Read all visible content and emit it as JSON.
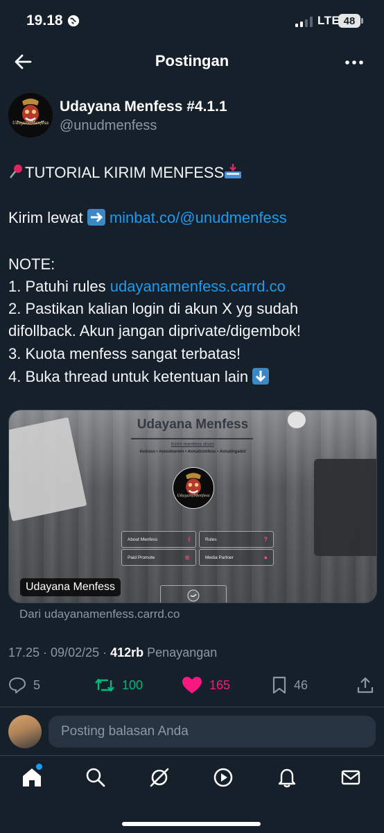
{
  "status_bar": {
    "time": "19.18",
    "network": "LTE",
    "battery": "48"
  },
  "header": {
    "title": "Postingan",
    "back_icon": "back-arrow-icon",
    "more_icon": "more-dots-icon"
  },
  "author": {
    "name": "Udayana Menfess #4.1.1",
    "handle": "@unudmenfess"
  },
  "post": {
    "title_line": "TUTORIAL KIRIM MENFESS",
    "send_prefix": "Kirim lewat ",
    "send_link": "minbat.co/@unudmenfess",
    "note_label": "NOTE:",
    "rule1_prefix": "1. Patuhi rules ",
    "rule1_link": "udayanamenfess.carrd.co",
    "rule2_line1": "2. Pastikan kalian login di akun X yg sudah",
    "rule2_line2": "difollback. Akun jangan diprivate/digembok!",
    "rule3": "3. Kuota menfess sangat terbatas!",
    "rule4": "4. Buka thread untuk ketentuan lain "
  },
  "card": {
    "site_title": "Udayana Menfess",
    "subtitle": "Kirim menfess disini",
    "tags": "#unissu • #unudserem • #unudconfess • #unudngadol",
    "buttons": [
      "About Menfess",
      "Rules",
      "Paid Promote",
      "Media Partner"
    ],
    "label": "Udayana Menfess",
    "source": "Dari udayanamenfess.carrd.co"
  },
  "meta": {
    "timestamp": "17.25 · 09/02/25 · ",
    "views_count": "412rb",
    "views_label": " Penayangan"
  },
  "actions": {
    "replies": "5",
    "reposts": "100",
    "likes": "165",
    "bookmarks": "46"
  },
  "reply": {
    "placeholder": "Posting balasan Anda"
  },
  "colors": {
    "background": "#15202b",
    "link": "#1d9bf0",
    "repost": "#00ba7c",
    "like": "#f91880",
    "muted": "#8b98a5"
  }
}
